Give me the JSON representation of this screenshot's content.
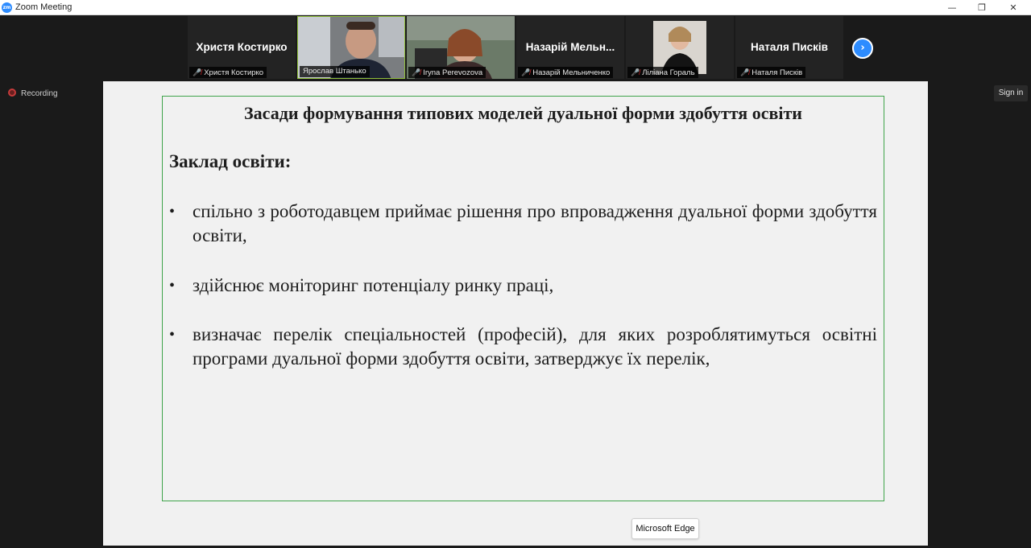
{
  "window": {
    "app_logo": "zm",
    "title": "Zoom Meeting",
    "minimize_glyph": "—",
    "maximize_glyph": "❐",
    "close_glyph": "✕"
  },
  "participants": [
    {
      "display_name": "Христя Костирко",
      "label": "Христя Костирко",
      "muted": true,
      "video": false
    },
    {
      "display_name": "",
      "label": "Ярослав Штанько",
      "muted": false,
      "video": true
    },
    {
      "display_name": "",
      "label": "Iryna Perevozova",
      "muted": true,
      "video": true
    },
    {
      "display_name": "Назарій Мельн...",
      "label": "Назарій Мельниченко",
      "muted": true,
      "video": false
    },
    {
      "display_name": "",
      "label": "Ліліана Гораль",
      "muted": true,
      "video": true
    },
    {
      "display_name": "Наталя Писків",
      "label": "Наталя Писків",
      "muted": true,
      "video": false
    }
  ],
  "next_page_glyph": "›",
  "recording": {
    "label": "Recording"
  },
  "signin": {
    "label": "Sign in"
  },
  "slide": {
    "title": "Засади формування типових моделей дуальної форми здобуття освіти",
    "subtitle": "Заклад освіти:",
    "bullet_char": "•",
    "bullets": [
      "спільно з роботодавцем приймає рішення про впровадження дуальної форми здобуття освіти,",
      "здійснює моніторинг потенціалу ринку праці,",
      "визначає перелік спеціальностей (професій), для яких розроблятимуться освітні програми дуальної форми здобуття освіти, затверджує їх перелік,"
    ]
  },
  "taskbar_tooltip": {
    "label": "Microsoft Edge"
  },
  "colors": {
    "accent": "#2d8cff",
    "slide_border": "#3fa44a",
    "muted_mic": "#e0282c",
    "active_speaker": "#8fbf3a"
  }
}
